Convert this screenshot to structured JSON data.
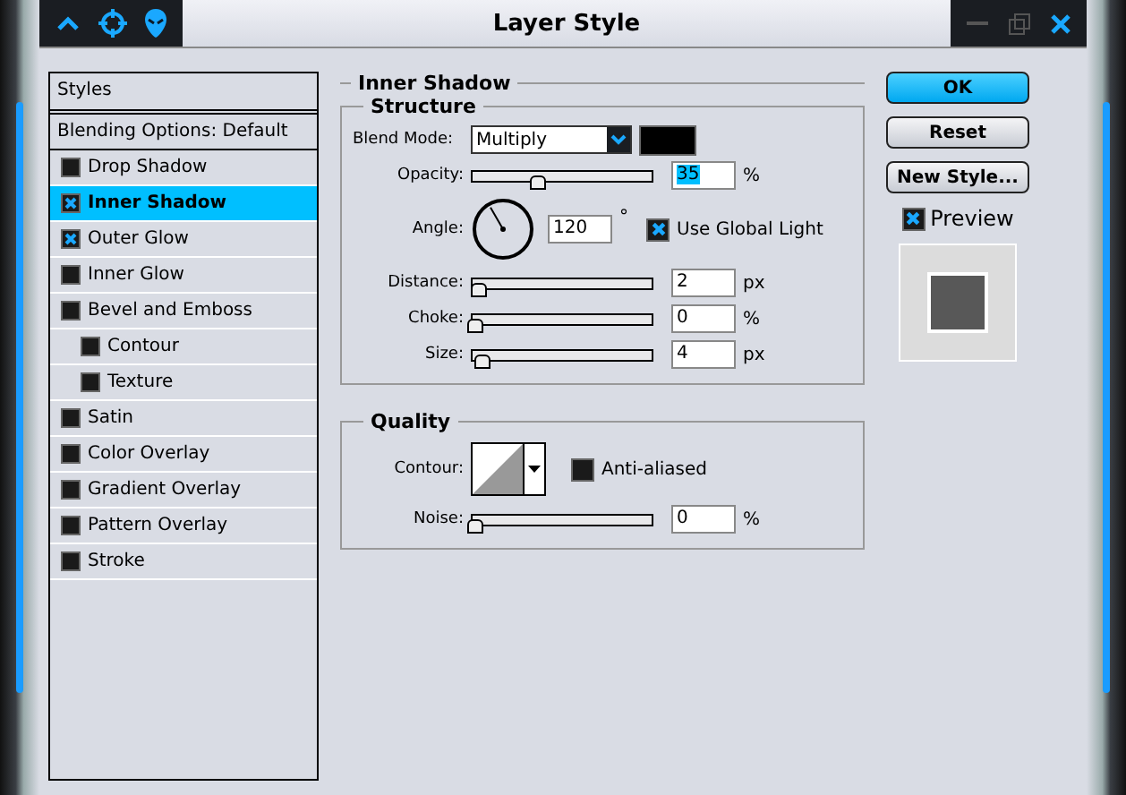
{
  "window": {
    "title": "Layer Style"
  },
  "sidebar": {
    "header": "Styles",
    "items": [
      {
        "label": "Blending Options: Default",
        "kind": "option",
        "selected": false
      },
      {
        "label": "Drop Shadow",
        "kind": "effect",
        "checked": false,
        "selected": false
      },
      {
        "label": "Inner Shadow",
        "kind": "effect",
        "checked": true,
        "selected": true
      },
      {
        "label": "Outer Glow",
        "kind": "effect",
        "checked": true,
        "selected": false
      },
      {
        "label": "Inner Glow",
        "kind": "effect",
        "checked": false,
        "selected": false
      },
      {
        "label": "Bevel and Emboss",
        "kind": "effect",
        "checked": false,
        "selected": false,
        "children": [
          {
            "label": "Contour",
            "kind": "effect",
            "checked": false,
            "selected": false
          },
          {
            "label": "Texture",
            "kind": "effect",
            "checked": false,
            "selected": false
          }
        ]
      },
      {
        "label": "Satin",
        "kind": "effect",
        "checked": false,
        "selected": false
      },
      {
        "label": "Color Overlay",
        "kind": "effect",
        "checked": false,
        "selected": false
      },
      {
        "label": "Gradient Overlay",
        "kind": "effect",
        "checked": false,
        "selected": false
      },
      {
        "label": "Pattern Overlay",
        "kind": "effect",
        "checked": false,
        "selected": false
      },
      {
        "label": "Stroke",
        "kind": "effect",
        "checked": false,
        "selected": false
      }
    ]
  },
  "panel": {
    "title": "Inner Shadow",
    "structure": {
      "title": "Structure",
      "blend_mode_label": "Blend Mode:",
      "blend_mode": "Multiply",
      "color": "#000000",
      "opacity": {
        "label": "Opacity:",
        "level": 0.35,
        "value": "35",
        "unit": "%"
      },
      "angle": {
        "label": "Angle:",
        "value": "120",
        "unit": "°",
        "global_light": {
          "label": "Use Global Light",
          "checked": true
        }
      },
      "sliders": [
        {
          "label": "Distance:",
          "level": 0.02,
          "value": "2",
          "unit": "px"
        },
        {
          "label": "Choke:",
          "level": 0,
          "value": "0",
          "unit": "%"
        },
        {
          "label": "Size:",
          "level": 0.04,
          "value": "4",
          "unit": "px"
        }
      ]
    },
    "quality": {
      "title": "Quality",
      "contour_label": "Contour:",
      "anti_aliased": {
        "label": "Anti-aliased",
        "checked": false
      },
      "noise": {
        "label": "Noise:",
        "level": 0,
        "value": "0",
        "unit": "%"
      }
    }
  },
  "buttons": [
    {
      "label": "OK",
      "default": true
    },
    {
      "label": "Reset",
      "default": false
    },
    {
      "label": "New Style...",
      "default": false
    }
  ],
  "preview": {
    "label": "Preview",
    "checked": true
  }
}
